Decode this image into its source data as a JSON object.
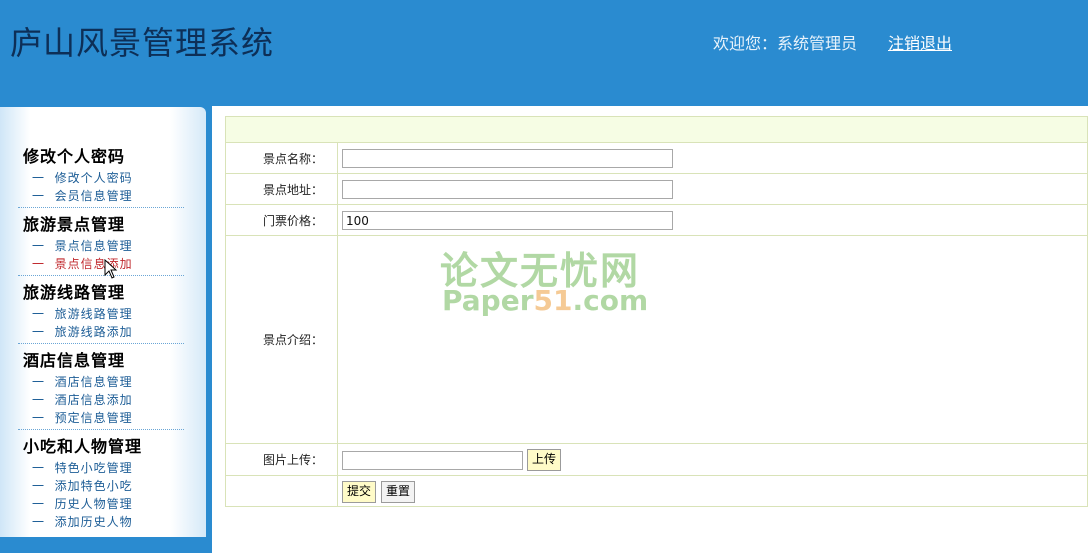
{
  "header": {
    "app_title": "庐山风景管理系统",
    "welcome_text": "欢迎您：系统管理员",
    "logout_label": "注销退出"
  },
  "sidebar": {
    "groups": [
      {
        "heading": "修改个人密码",
        "items": [
          {
            "label": "修改个人密码"
          },
          {
            "label": "会员信息管理"
          }
        ]
      },
      {
        "heading": "旅游景点管理",
        "items": [
          {
            "label": "景点信息管理"
          },
          {
            "label": "景点信息添加",
            "active": true
          }
        ]
      },
      {
        "heading": "旅游线路管理",
        "items": [
          {
            "label": "旅游线路管理"
          },
          {
            "label": "旅游线路添加"
          }
        ]
      },
      {
        "heading": "酒店信息管理",
        "items": [
          {
            "label": "酒店信息管理"
          },
          {
            "label": "酒店信息添加"
          },
          {
            "label": "预定信息管理"
          }
        ]
      },
      {
        "heading": "小吃和人物管理",
        "items": [
          {
            "label": "特色小吃管理"
          },
          {
            "label": "添加特色小吃"
          },
          {
            "label": "历史人物管理"
          },
          {
            "label": "添加历史人物"
          }
        ]
      }
    ],
    "item_prefix": "一"
  },
  "form": {
    "name_label": "景点名称：",
    "name_value": "",
    "address_label": "景点地址：",
    "address_value": "",
    "price_label": "门票价格：",
    "price_value": "100",
    "intro_label": "景点介绍：",
    "image_label": "图片上传：",
    "upload_label": "上传",
    "submit_label": "提交",
    "reset_label": "重置"
  },
  "watermark": {
    "cn_text": "论文无忧网",
    "en_prefix": "Paper",
    "en_number": "51",
    "en_suffix": ".com"
  },
  "colors": {
    "header_bg": "#2a8bd0",
    "title_color": "#0d2f57",
    "nav_link": "#1d5d96",
    "nav_active": "#c0282d",
    "form_header_bg": "#f6fde4",
    "button_bg": "#fffbc8"
  }
}
